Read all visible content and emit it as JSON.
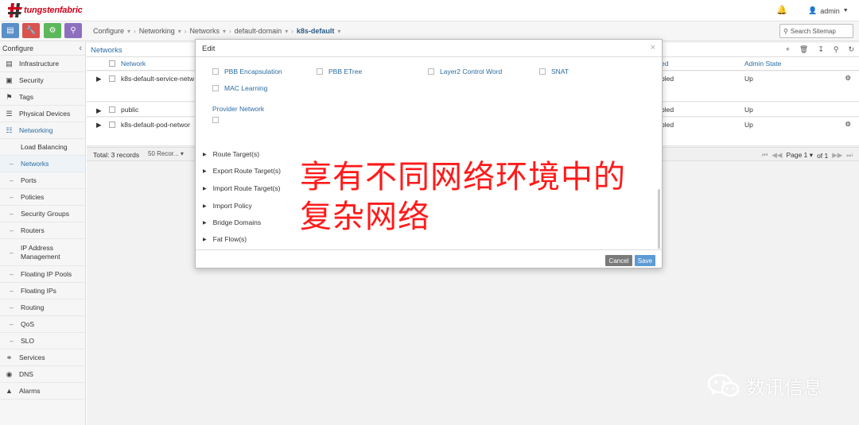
{
  "header": {
    "logo_text": "tungstenfabric",
    "user": "admin"
  },
  "navbar": {
    "breadcrumb": [
      "Configure",
      "Networking",
      "Networks",
      "default-domain",
      "k8s-default"
    ],
    "search_placeholder": "Search Sitemap"
  },
  "sidebar": {
    "title": "Configure",
    "items": [
      {
        "label": "Infrastructure",
        "icon": "server-icon"
      },
      {
        "label": "Security",
        "icon": "security-icon"
      },
      {
        "label": "Tags",
        "icon": "tags-icon"
      },
      {
        "label": "Physical Devices",
        "icon": "devices-icon"
      },
      {
        "label": "Networking",
        "icon": "network-icon"
      }
    ],
    "sub_items": [
      "Load Balancing",
      "Networks",
      "Ports",
      "Policies",
      "Security Groups",
      "Routers",
      "IP Address Management",
      "Floating IP Pools",
      "Floating IPs",
      "Routing",
      "QoS",
      "SLO"
    ],
    "bottom_items": [
      {
        "label": "Services",
        "icon": "services-icon"
      },
      {
        "label": "DNS",
        "icon": "dns-icon"
      },
      {
        "label": "Alarms",
        "icon": "alarm-icon"
      }
    ]
  },
  "grid": {
    "title": "Networks",
    "columns": [
      "Network",
      "ed",
      "Admin State"
    ],
    "rows": [
      {
        "network": "k8s-default-service-netw",
        "status": "bled",
        "admin": "Up"
      },
      {
        "network": "public",
        "status": "bled",
        "admin": "Up"
      },
      {
        "network": "k8s-default-pod-networ",
        "status": "bled",
        "admin": "Up"
      }
    ],
    "total": "Total: 3 records",
    "records_per_page": "50 Recor...",
    "page_label": "Page 1",
    "of_label": "of 1"
  },
  "modal": {
    "title": "Edit",
    "checkboxes": [
      "PBB Encapsulation",
      "PBB ETree",
      "Layer2 Control Word",
      "SNAT",
      "MAC Learning"
    ],
    "provider_network": "Provider Network",
    "sections": [
      "Route Target(s)",
      "Export Route Target(s)",
      "Import Route Target(s)",
      "Import Policy",
      "Bridge Domains",
      "Fat Flow(s)"
    ],
    "cancel_label": "Cancel",
    "save_label": "Save"
  },
  "caption": {
    "line1": "享有不同网络环境中的",
    "line2": "复杂网络"
  },
  "watermark": {
    "text": "数讯信息"
  }
}
